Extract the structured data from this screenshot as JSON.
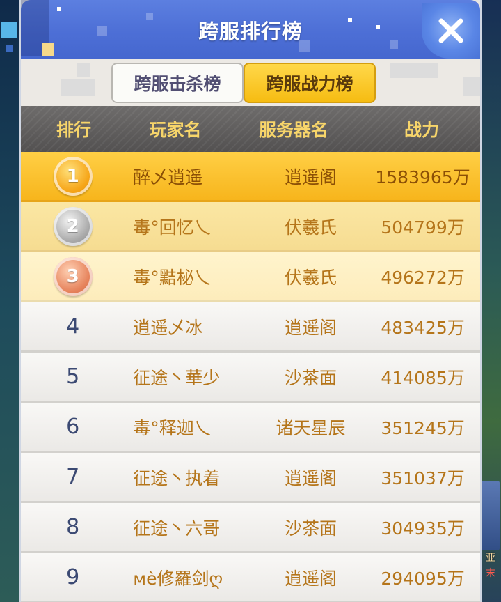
{
  "window": {
    "title": "跨服排行榜",
    "close_icon": "close-icon"
  },
  "tabs": [
    {
      "label": "跨服击杀榜",
      "active": false
    },
    {
      "label": "跨服战力榜",
      "active": true
    }
  ],
  "table": {
    "headers": [
      "排行",
      "玩家名",
      "服务器名",
      "战力"
    ],
    "rows": [
      {
        "rank": "1",
        "medal": "gold",
        "player": "醉乄逍遥",
        "server": "逍遥阁",
        "power": "1583965万"
      },
      {
        "rank": "2",
        "medal": "silver",
        "player": "毒°回忆乀",
        "server": "伏羲氏",
        "power": "504799万"
      },
      {
        "rank": "3",
        "medal": "bronze",
        "player": "毒°黠柲乀",
        "server": "伏羲氏",
        "power": "496272万"
      },
      {
        "rank": "4",
        "player": "逍遥乄冰",
        "server": "逍遥阁",
        "power": "483425万"
      },
      {
        "rank": "5",
        "player": "征途丶華少",
        "server": "沙茶面",
        "power": "414085万"
      },
      {
        "rank": "6",
        "player": "毒°释迦乀",
        "server": "诸天星辰",
        "power": "351245万"
      },
      {
        "rank": "7",
        "player": "征途丶执着",
        "server": "逍遥阁",
        "power": "351037万"
      },
      {
        "rank": "8",
        "player": "征途丶六哥",
        "server": "沙茶面",
        "power": "304935万"
      },
      {
        "rank": "9",
        "player": "мè修羅剑ღ",
        "server": "逍遥阁",
        "power": "294095万"
      }
    ]
  },
  "background": {
    "side_text_1": "亚",
    "side_text_2": "末"
  },
  "colors": {
    "title_bar": "#4d6fd6",
    "active_tab": "#f6bc12",
    "header_text": "#f7d56a",
    "row_text": "#b5751a",
    "rank_text": "#3c4a73"
  }
}
